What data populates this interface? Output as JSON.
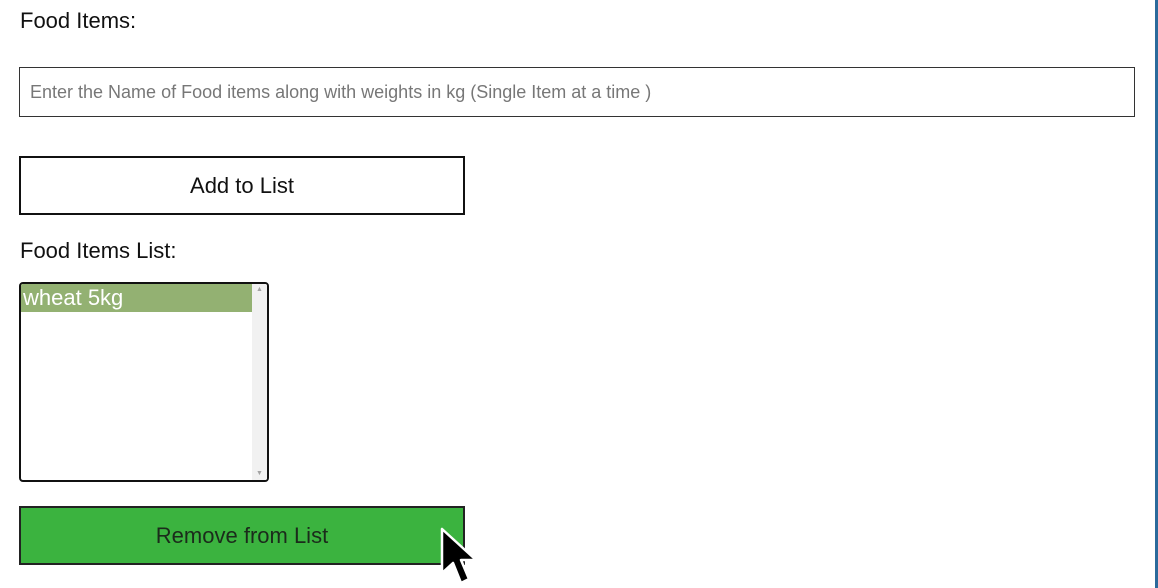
{
  "form": {
    "food_items_label": "Food Items:",
    "food_input": {
      "value": "",
      "placeholder": "Enter the Name of Food items along with weights in kg (Single Item at a time )"
    },
    "add_button_label": "Add to List",
    "list_label": "Food Items List:",
    "list_items": [
      "wheat 5kg"
    ],
    "remove_button_label": "Remove from List"
  },
  "scrollbar": {
    "up_icon": "scroll-up-arrow-icon",
    "down_icon": "scroll-down-arrow-icon"
  },
  "colors": {
    "selected_item_bg": "#93b172",
    "remove_button_bg": "#3bb33f",
    "right_border": "#2b6a9b"
  },
  "cursor": {
    "icon": "mouse-pointer-icon"
  }
}
